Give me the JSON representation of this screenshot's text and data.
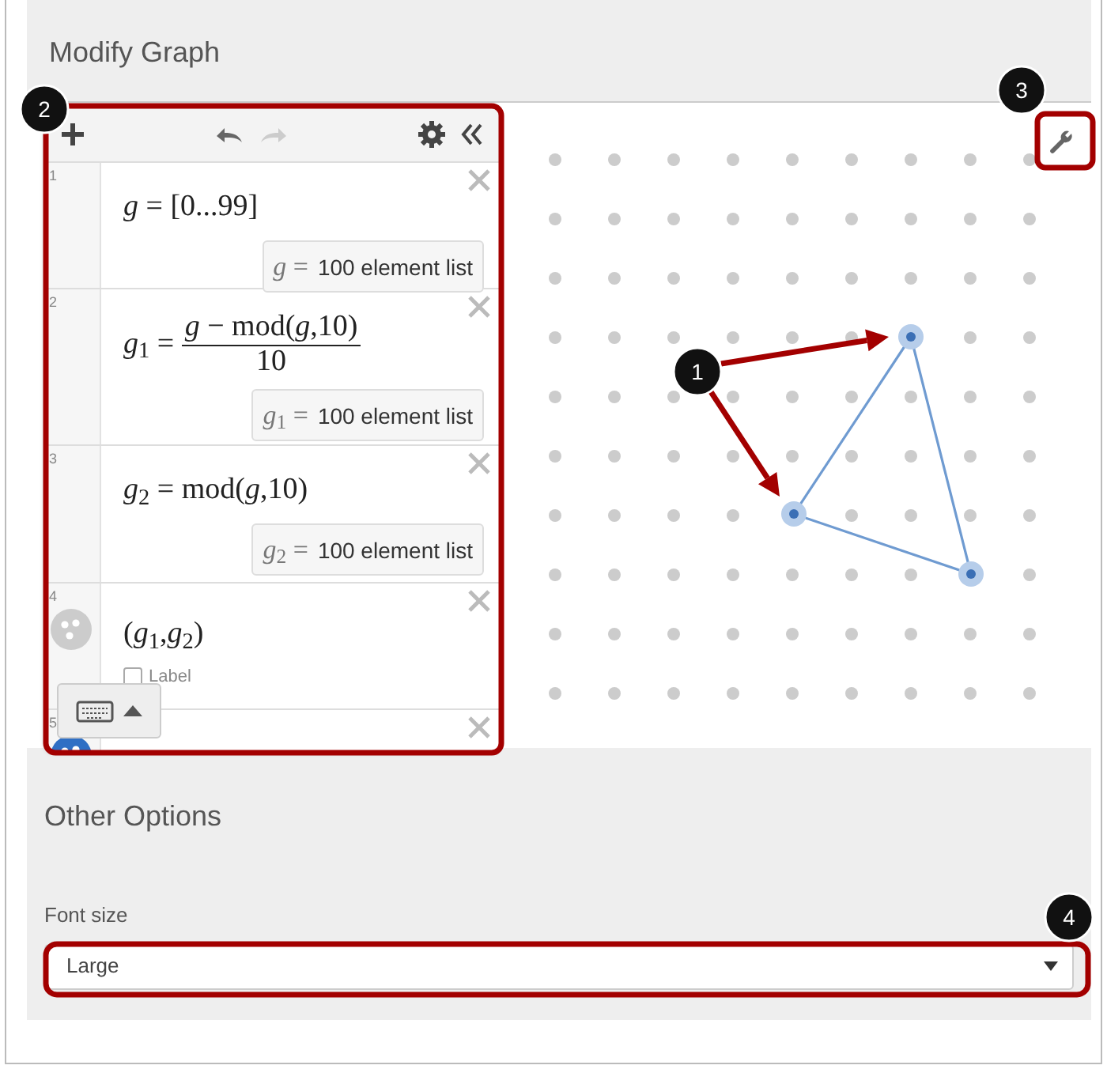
{
  "title": "Modify Graph",
  "toolbar": {
    "undo": {
      "disabled": false
    },
    "redo": {
      "disabled": true
    }
  },
  "expressions": [
    {
      "number": "1",
      "kind": "equation",
      "expr": "*g* = [0...99]",
      "result_var": "*g* =",
      "result": "100 element list"
    },
    {
      "number": "2",
      "kind": "fraction",
      "lhs": "*g*$_{1}$ =",
      "numerator": "*g* − mod(*g*,10)",
      "denominator": "10",
      "result_var": "*g*$_{1}$ =",
      "result": "100 element list"
    },
    {
      "number": "3",
      "kind": "equation",
      "expr": "*g*$_{2}$ = mod(*g*,10)",
      "result_var": "*g*$_{2}$ =",
      "result": "100 element list"
    },
    {
      "number": "4",
      "kind": "point",
      "expr": "(*g*$_{1}$,*g*$_{2}$)",
      "color": "#cccccc",
      "label_checkbox": {
        "text": "Label",
        "checked": false
      }
    },
    {
      "number": "5",
      "kind": "partial",
      "color": "#2f6fc4"
    }
  ],
  "other_options": {
    "heading": "Other Options",
    "font_size": {
      "label": "Font size",
      "value": "Large"
    }
  },
  "callouts": [
    {
      "number": "1"
    },
    {
      "number": "2"
    },
    {
      "number": "3"
    },
    {
      "number": "4"
    }
  ]
}
